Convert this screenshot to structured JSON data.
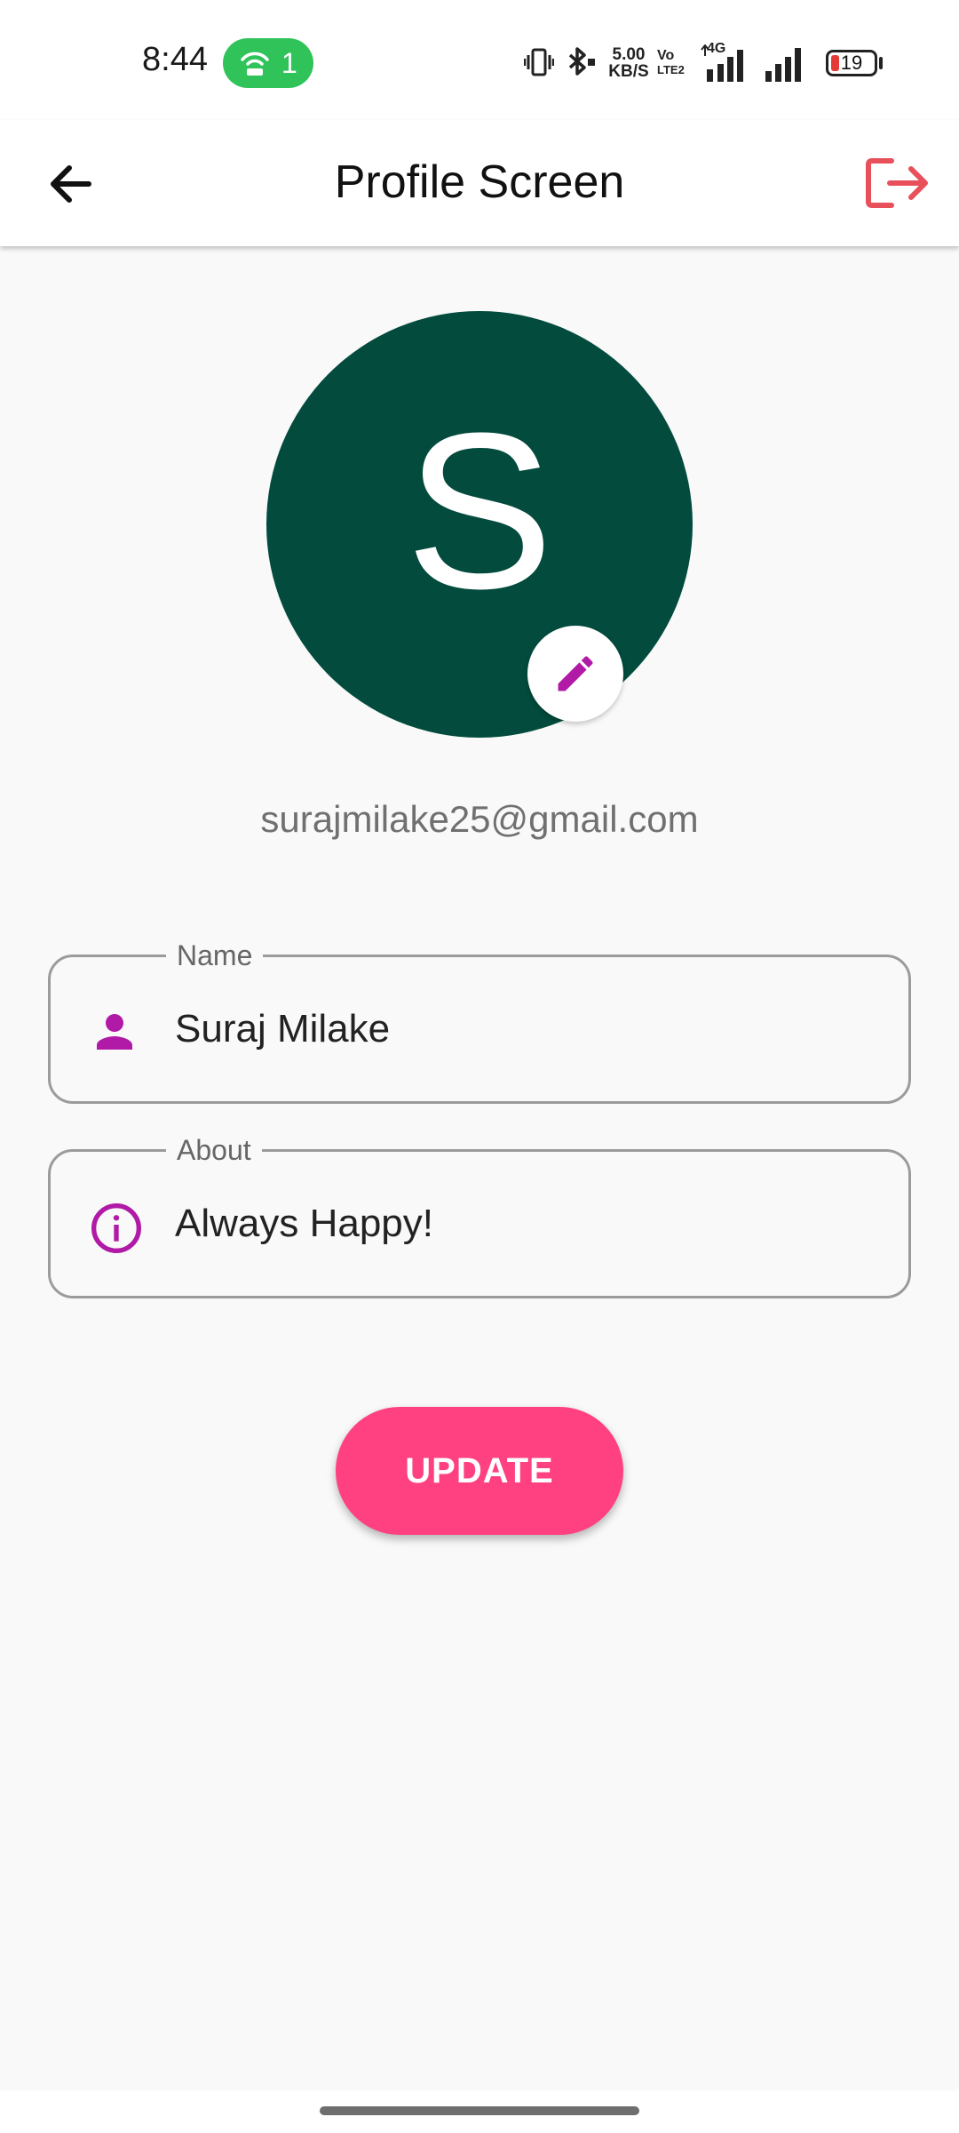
{
  "status_bar": {
    "time": "8:44",
    "hotspot_count": "1",
    "net_speed_value": "5.00",
    "net_speed_unit": "KB/S",
    "volte_top": "Vo",
    "volte_bottom": "LTE2",
    "network_type": "4G",
    "battery_level": "19",
    "battery_fraction": 0.19,
    "hotspot_color": "#2fc35a",
    "battery_low_color": "#e53935",
    "icons": [
      "hotspot-icon",
      "vibrate-icon",
      "bluetooth-icon",
      "signal-4g-icon",
      "signal-icon",
      "battery-icon"
    ]
  },
  "app_bar": {
    "title": "Profile Screen",
    "back_icon": "arrow-left-icon",
    "logout_icon": "logout-icon",
    "logout_color": "#e53935"
  },
  "profile": {
    "avatar_letter": "S",
    "avatar_color": "#024b3d",
    "edit_icon": "pencil-icon",
    "email": "surajmilake25@gmail.com"
  },
  "form": {
    "name": {
      "label": "Name",
      "value": "Suraj Milake",
      "icon": "person-icon"
    },
    "about": {
      "label": "About",
      "value": "Always Happy!",
      "icon": "info-icon"
    },
    "icon_color": "#b01aa7"
  },
  "actions": {
    "update_label": "UPDATE",
    "update_color": "#ff4081"
  }
}
